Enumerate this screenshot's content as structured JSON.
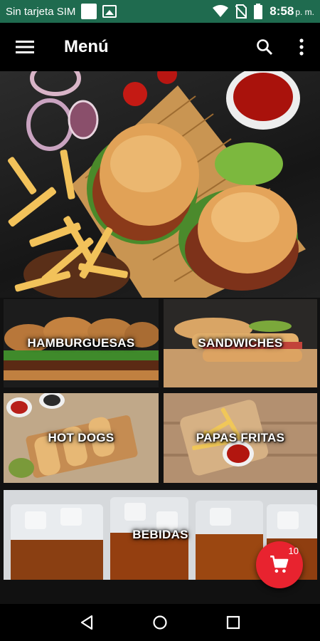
{
  "status_bar": {
    "carrier": "Sin tarjeta SIM",
    "time": "8:58",
    "ampm": "p. m.",
    "icons": [
      "notification-square-icon",
      "image-icon",
      "wifi-icon",
      "no-sim-icon",
      "battery-icon"
    ]
  },
  "app_bar": {
    "title": "Menú",
    "icons": [
      "hamburger-menu-icon",
      "search-icon",
      "more-vert-icon"
    ]
  },
  "categories": [
    {
      "label": "HAMBURGUESAS"
    },
    {
      "label": "SANDWICHES"
    },
    {
      "label": "HOT DOGS"
    },
    {
      "label": "PAPAS FRITAS"
    },
    {
      "label": "BEBIDAS"
    }
  ],
  "cart": {
    "count": "10",
    "accent": "#e8232f"
  },
  "nav_bar": {
    "icons": [
      "back-icon",
      "home-icon",
      "recents-icon"
    ]
  },
  "colors": {
    "status_bar": "#1f6b4f",
    "app_bar": "#000000"
  }
}
